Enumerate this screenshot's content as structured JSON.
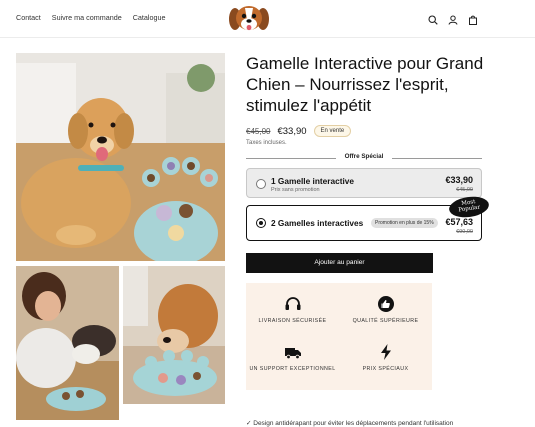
{
  "header": {
    "nav": [
      "Contact",
      "Suivre ma commande",
      "Catalogue"
    ],
    "icons": [
      "search-icon",
      "account-icon",
      "cart-icon"
    ]
  },
  "product": {
    "title": "Gamelle Interactive pour Grand Chien – Nourrissez l'esprit, stimulez l'appétit",
    "compare_price": "€45,00",
    "price": "€33,90",
    "sale_badge": "En vente",
    "taxes": "Taxes incluses."
  },
  "offer": {
    "heading": "Offre Spécial",
    "options": [
      {
        "name": "1 Gamelle interactive",
        "subtitle": "Prix sans promotion",
        "price": "€33,90",
        "compare": "€45,00",
        "selected": false
      },
      {
        "name": "2 Gamelles interactives",
        "badge": "Promotion en plus de 15%",
        "price": "€57,63",
        "compare": "€90,00",
        "selected": true
      }
    ],
    "popular_line1": "Most",
    "popular_line2": "Popular"
  },
  "cart_button": "Ajouter au panier",
  "features": [
    {
      "icon": "headset-icon",
      "label": "LIVRAISON SÉCURISÉE"
    },
    {
      "icon": "thumbs-up-icon",
      "label": "QUALITÉ SUPÉRIEURE"
    },
    {
      "icon": "truck-icon",
      "label": "UN SUPPORT EXCEPTIONNEL"
    },
    {
      "icon": "lightning-icon",
      "label": "PRIX SPÉCIAUX"
    }
  ],
  "bullet": "✓ Design antidérapant pour éviter les déplacements pendant l'utilisation",
  "colors": {
    "accent": "#121212",
    "features_bg": "#fbf1e8",
    "option_bg": "#ececec"
  }
}
